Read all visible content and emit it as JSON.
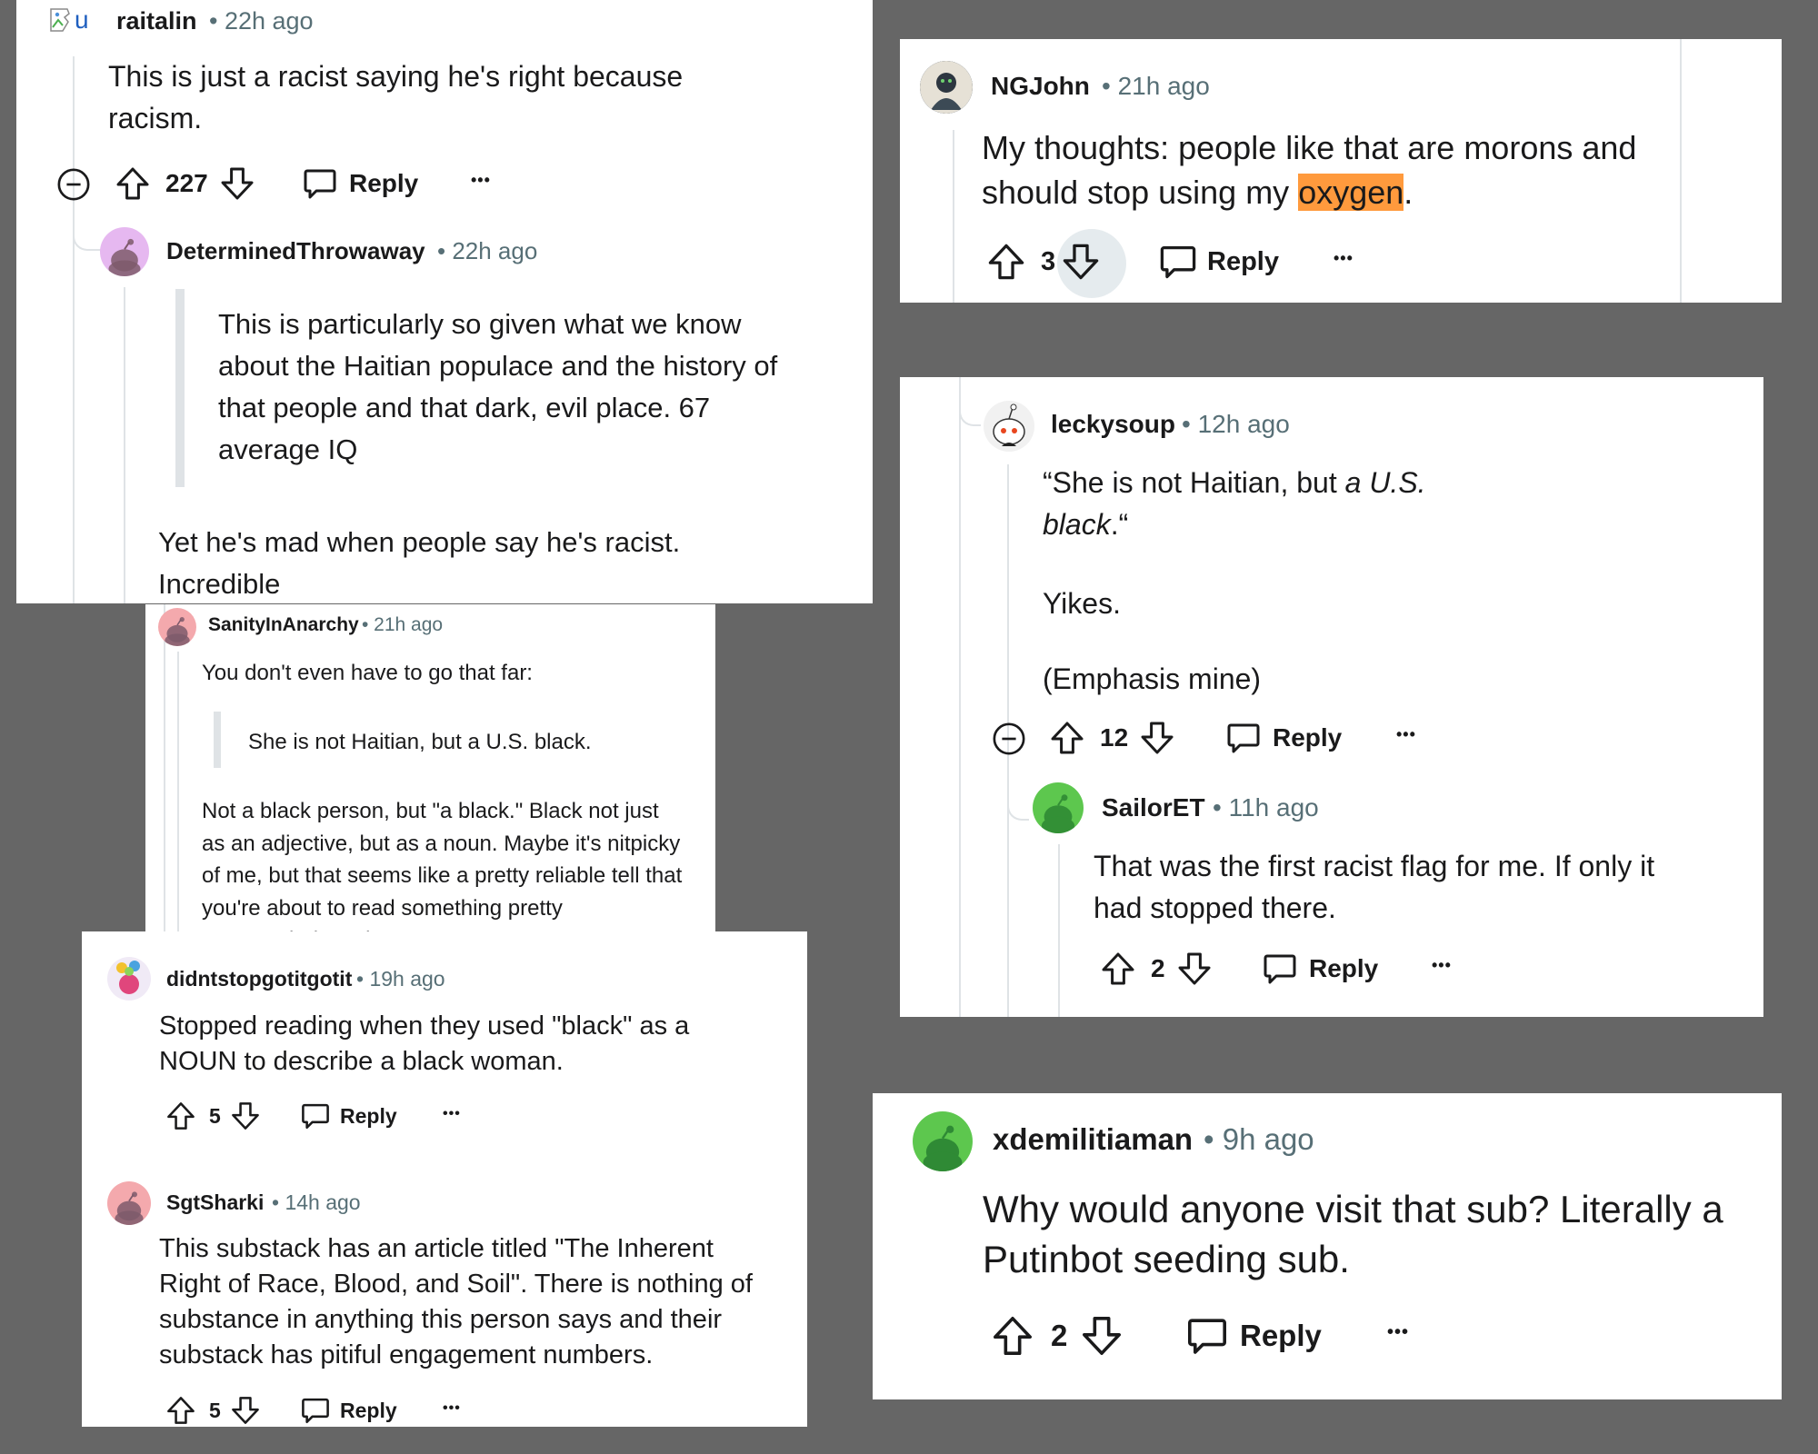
{
  "colors": {
    "background": "#666666",
    "card": "#ffffff",
    "thread_line": "#dfe3e6",
    "meta_text": "#576f76",
    "highlight": "#ff9a3d"
  },
  "c1": {
    "broken_avatar_text": "u",
    "user": "raitalin",
    "time": "• 22h ago",
    "body": "This is just a racist saying he's right because racism.",
    "votes": "227",
    "reply": "Reply",
    "more": "•••"
  },
  "c2": {
    "user": "DeterminedThrowaway",
    "time": "• 22h ago",
    "quote": "This is particularly so given what we know about the Haitian populace and the history of that people and that dark, evil place. 67 average IQ",
    "body": "Yet he's mad when people say he's racist. Incredible"
  },
  "c3": {
    "user": "SanityInAnarchy",
    "time": "• 21h ago",
    "intro": "You don't even have to go that far:",
    "quote": "She is not Haitian, but a U.S. black.",
    "body": "Not a black person, but \"a black.\" Black not just as an adjective, but as a noun. Maybe it's nitpicky of me, but that seems like a pretty reliable tell that you're about to read something pretty spectacularly racist."
  },
  "c4": {
    "user": "didntstopgotitgotit",
    "time": "• 19h ago",
    "body": "Stopped reading when they used \"black\" as a NOUN to describe a black woman.",
    "votes": "5",
    "reply": "Reply",
    "more": "•••"
  },
  "c5": {
    "user": "SgtSharki",
    "time": "• 14h ago",
    "body": "This substack has an article titled \"The Inherent Right of Race, Blood, and Soil\". There is nothing of substance in anything this person says and their substack has pitiful engagement numbers.",
    "votes": "5",
    "reply": "Reply",
    "more": "•••"
  },
  "c6": {
    "user": "NGJohn",
    "time": "• 21h ago",
    "body_before": "My thoughts: people like that are morons and should stop using my ",
    "body_highlight": "oxygen",
    "body_after": ".",
    "votes": "3",
    "reply": "Reply",
    "more": "•••"
  },
  "c7": {
    "user": "leckysoup",
    "time": "• 12h ago",
    "quote_start": "“She is not Haitian, but ",
    "quote_italic": "a U.S. black",
    "quote_end": ".“",
    "line2": "Yikes.",
    "line3": "(Emphasis mine)",
    "votes": "12",
    "reply": "Reply",
    "more": "•••"
  },
  "c8": {
    "user": "SailorET",
    "time": "• 11h ago",
    "body": "That was the first racist flag for me. If only it had stopped there.",
    "votes": "2",
    "reply": "Reply",
    "more": "•••"
  },
  "c9": {
    "user": "xdemilitiaman",
    "time": "• 9h ago",
    "body": "Why would anyone visit that sub? Literally a Putinbot seeding sub.",
    "votes": "2",
    "reply": "Reply",
    "more": "•••"
  },
  "icons": [
    "upvote-icon",
    "downvote-icon",
    "comment-bubble-icon",
    "collapse-icon",
    "snoo-avatar-icon",
    "broken-image-icon"
  ]
}
